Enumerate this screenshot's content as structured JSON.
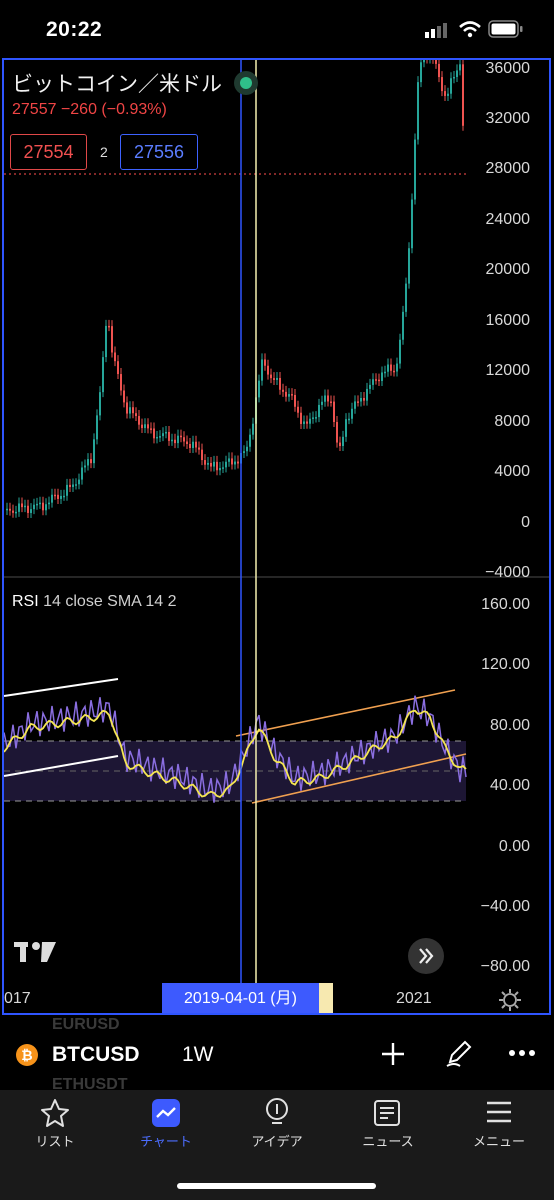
{
  "status_bar": {
    "time": "20:22"
  },
  "chart": {
    "pair_title": "ビットコイン／米ドル",
    "quote": "27557 −260 (−0.93%)",
    "bid": "27554",
    "spread": "2",
    "ask": "27556",
    "price_axis": [
      "36000",
      "32000",
      "28000",
      "24000",
      "20000",
      "16000",
      "12000",
      "8000",
      "4000",
      "0",
      "−4000"
    ],
    "rsi_title": "RSI",
    "rsi_params": "14 close SMA 14 2",
    "rsi_axis": [
      "160.00",
      "120.00",
      "80.00",
      "40.00",
      "0.00",
      "−40.00",
      "−80.00"
    ],
    "x_labels": {
      "left": "017",
      "right": "2021"
    },
    "crosshair_date": "2019-04-01 (月)",
    "colors": {
      "up": "#26a69a",
      "down": "#ef5350",
      "rsi": "#7e57c2",
      "rsi_sma": "#f5e653",
      "channel": "#f0a050",
      "crosshair_blue": "#2f55ff"
    }
  },
  "toolbar": {
    "ghost_top": "EURUSD",
    "ghost_bottom": "ETHUSDT",
    "coin_glyph": "₿",
    "symbol": "BTCUSD",
    "interval": "1W",
    "icons": [
      "plus-icon",
      "pencil-icon",
      "more-icon"
    ]
  },
  "nav": [
    {
      "label": "リスト",
      "icon": "star-icon"
    },
    {
      "label": "チャート",
      "icon": "chart-icon",
      "active": true
    },
    {
      "label": "アイデア",
      "icon": "idea-icon"
    },
    {
      "label": "ニュース",
      "icon": "news-icon"
    },
    {
      "label": "メニュー",
      "icon": "menu-icon"
    }
  ]
}
